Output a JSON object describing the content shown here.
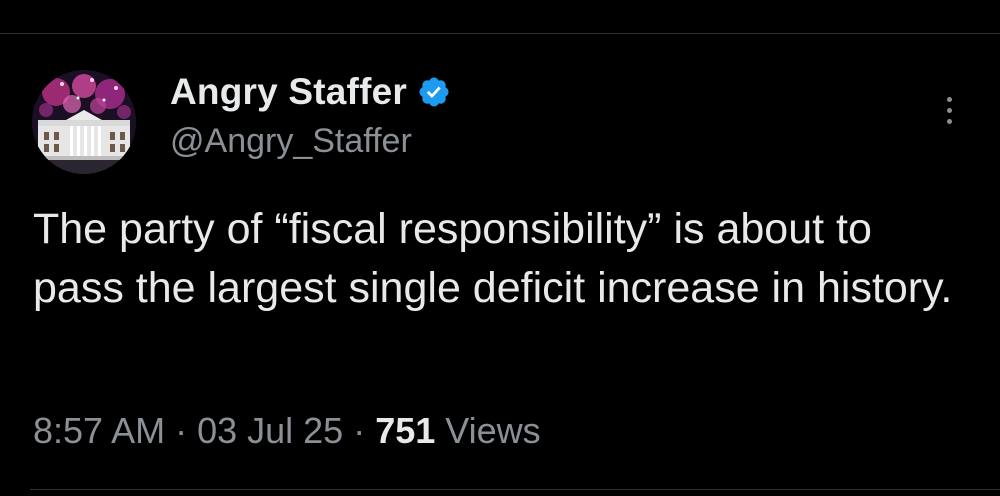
{
  "tweet": {
    "author": {
      "display_name": "Angry Staffer",
      "handle": "@Angry_Staffer",
      "verified": true,
      "avatar_icon": "white-house-fireworks-avatar"
    },
    "text": "The party of “fiscal responsibility” is about to pass the largest single deficit increase in history.",
    "time": "8:57 AM",
    "date": "03 Jul 25",
    "separator": "·",
    "views_count": "751",
    "views_label": "Views",
    "more_icon": "more-vertical-icon"
  },
  "colors": {
    "background": "#000000",
    "text_primary": "#e7e9ea",
    "text_secondary": "#8b9096",
    "verified_badge": "#1d9bf0",
    "divider": "#2f3336"
  }
}
